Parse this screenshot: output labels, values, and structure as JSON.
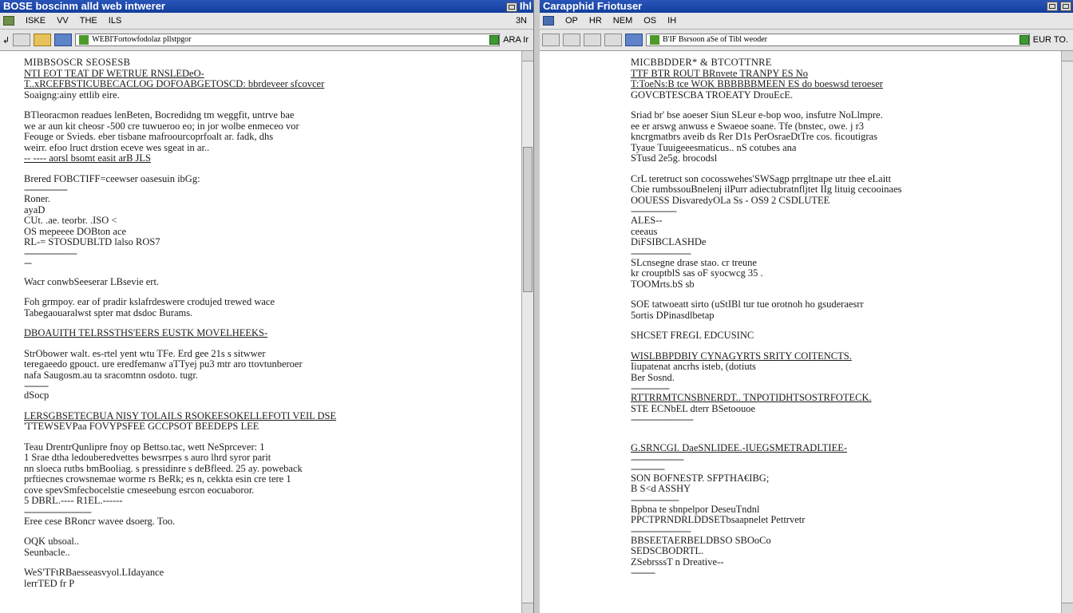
{
  "left": {
    "title": "BOSE boscinm alld web intwerer",
    "title_right": "Ihl",
    "menus": [
      "ISKE",
      "VV",
      "THE",
      "ILS"
    ],
    "menu_right": "3N",
    "address": "WEBI'Fortowfodolaz pllstpgor",
    "toolbar_right": "ARA Ir",
    "lines": [
      {
        "t": "MIBBSOSCR  SEOSESB",
        "c": "h"
      },
      {
        "t": "NTI EOT TEAT DF WETRUE RNSLEDeO-",
        "c": "u"
      },
      {
        "t": "T..xRCEFBSTICUBECACLOG DOFOABGETOSCD: bbrdeveer  sfcovcer",
        "c": "u"
      },
      {
        "t": "Soaigng:ainy  ettlib eire.",
        "c": ""
      },
      {
        "t": "",
        "c": "gap"
      },
      {
        "t": "BTleoracmon  readues  lenBeten, Bocredidng  tm  weggfit, untrve  bae",
        "c": ""
      },
      {
        "t": "we  ar  aun  kit  cheosr -500 cre  tuwueroo  eo; in  jor  wolbe  enmeceo  vor",
        "c": ""
      },
      {
        "t": "Feouge  or  Svieds.  eber  tisbane mafroourcoprfoalt  ar.  fadk,  dhs",
        "c": ""
      },
      {
        "t": "weirr.  efoo  lruct  drstion  eceve  wes  sgeat  in ar..",
        "c": ""
      },
      {
        "t": "--  ----  aorsl  bsomt  easit  arB JLS",
        "c": "u"
      },
      {
        "t": "",
        "c": "gap"
      },
      {
        "t": "Brered FOBCTIFF=ceewser oasesuin ibGg:",
        "c": ""
      },
      {
        "t": "------------------",
        "c": "dash"
      },
      {
        "t": "Roner.",
        "c": ""
      },
      {
        "t": "ayaD",
        "c": ""
      },
      {
        "t": "CUt. .ae.  teorbr. .ISO  <",
        "c": ""
      },
      {
        "t": "OS  mepeeee DOBton ace",
        "c": ""
      },
      {
        "t": "RL-=  STOSDUBLTD  lalso  ROS7",
        "c": ""
      },
      {
        "t": "----------------------",
        "c": "dash"
      },
      {
        "t": "---",
        "c": "dash"
      },
      {
        "t": "",
        "c": "gap"
      },
      {
        "t": "Wacr  conwbSeeserar  LBsevie  ert.",
        "c": ""
      },
      {
        "t": "",
        "c": "gap"
      },
      {
        "t": "Foh  grmpoy.  ear  of  pradir  kslafrdeswere  crodujed  trewed  wace",
        "c": ""
      },
      {
        "t": "Tabegaouaralwst  spter  mat  dsdoc  Burams.",
        "c": ""
      },
      {
        "t": "",
        "c": "gap"
      },
      {
        "t": "DBOAUITH  TELRSSTHS'EERS  EUSTK MOVELHEEKS-",
        "c": "u"
      },
      {
        "t": "",
        "c": "gap"
      },
      {
        "t": "StrObower  walt.  es-rtel  yent  wtu  TFe. Erd gee  21s  s  sitwwer",
        "c": ""
      },
      {
        "t": "teregaeedo  gpouct.  ure  eredfemanw  aTTyej  pu3  mtr  aro  ttovtunberoer",
        "c": ""
      },
      {
        "t": "nafa  Saugosm.au  ta  sracomtnn  osdoto.  tugr.",
        "c": ""
      },
      {
        "t": "----------",
        "c": "dash"
      },
      {
        "t": "dSocp",
        "c": ""
      },
      {
        "t": "",
        "c": "gap"
      },
      {
        "t": "LERSGBSETECBUA  NISY  TOLAILS  RSOKEESOKELLEFOTI  VEIL  DSE",
        "c": "u"
      },
      {
        "t": "'TTEWSEVPaa  FOVYPSFEE  GCCPSOT  BEEDEPS  LEE",
        "c": ""
      },
      {
        "t": "",
        "c": "gap"
      },
      {
        "t": "Teau  DrentrQunlipre  fnoy  op  Bettso.tac,  wett  NeSprcever:  1",
        "c": ""
      },
      {
        "t": "1 Srae  dtha  ledouberedvettes  bewsrrpes  s  auro  lhrd  syror  parit",
        "c": ""
      },
      {
        "t": "nn  sloeca  rutbs  bmBooliag.  s  pressidinre  s  deBfleed.  25  ay.  poweback",
        "c": ""
      },
      {
        "t": "prftiecnes  crowsnemae  worme  rs  BeRk;  es  n,  cekkta  esin  cre  tere  1",
        "c": ""
      },
      {
        "t": "cove  spevSmfecbocelstie  cmeseebung  esrcon  eocuaboror.",
        "c": ""
      },
      {
        "t": "5  DBRL.----  R1EL.------",
        "c": ""
      },
      {
        "t": "----------------------------",
        "c": "dash"
      },
      {
        "t": "Eree  cese  BRoncr  wavee  dsoerg.  Too.",
        "c": ""
      },
      {
        "t": "",
        "c": "gap"
      },
      {
        "t": "OQK  ubsoal..",
        "c": ""
      },
      {
        "t": "Seunbacle..",
        "c": ""
      },
      {
        "t": "",
        "c": "gap"
      },
      {
        "t": "WeS'TFtRBaesseasvyol.LIdayance",
        "c": ""
      },
      {
        "t": "lerrTED  fr  P",
        "c": ""
      }
    ]
  },
  "right": {
    "title": "Carapphid Friotuser",
    "title_right": "",
    "menus": [
      "OP",
      "HR",
      "NEM",
      "OS",
      "IH"
    ],
    "menu_right": "",
    "address": "B'IF Bsrsoon aSe of Tibl weoder",
    "toolbar_right": "EUR TO.",
    "lines": [
      {
        "t": "MICBBDDER* &  BTCOTTNRE",
        "c": "h"
      },
      {
        "t": "TTF  BTR  ROUT  BRnvete  TRANPY  ES  No",
        "c": "u"
      },
      {
        "t": "T:ToeNs:B  tce  WOK  BBBBBBMEEN ES  do  boeswsd  teroeser",
        "c": "u"
      },
      {
        "t": "GOVCBTESCBA  TROEATY  DrouEcE.",
        "c": ""
      },
      {
        "t": "",
        "c": "gap"
      },
      {
        "t": "Sriad br'  bse   aoeser  Siun  SLeur  e-bop  woo,  insfutre  NoLlmpre.",
        "c": ""
      },
      {
        "t": "ee  er  arswg  anwuss  e  Swaeoe  soane.  Tfe  (bnstec,  owe.  j  r3",
        "c": ""
      },
      {
        "t": "kncrgmatbrs  aveib  ds  Rer  D1s  PerOsraeDtTre  cos.  ficoutigras",
        "c": ""
      },
      {
        "t": "Tyaue  Tuuigeeesmaticus..  nS  cotubes  ana",
        "c": ""
      },
      {
        "t": "STusd  2e5g.  brocodsl",
        "c": ""
      },
      {
        "t": "",
        "c": "gap"
      },
      {
        "t": "CrL  teretruct  son  cocosswehes'SWSagp prrgltnape  utr  thee  eLaitt",
        "c": ""
      },
      {
        "t": "Cbie  rumbssouBnelenj  ilPurr  adiectubratnfljtet  IIg  lituig  cecooinaes",
        "c": ""
      },
      {
        "t": "OOUESS  DisvaredyOLa  Ss  -  OS9  2  CSDLUTEE",
        "c": ""
      },
      {
        "t": "-------------------",
        "c": "dash"
      },
      {
        "t": "ALES--",
        "c": ""
      },
      {
        "t": "ceeaus",
        "c": ""
      },
      {
        "t": "DiFSIBCLASHDe",
        "c": ""
      },
      {
        "t": "-------------------------",
        "c": "dash"
      },
      {
        "t": "SLcnsegne  drase  stao.  cr  treune",
        "c": ""
      },
      {
        "t": "kr  crouptblS  sas  oF  syocwcg  35 .",
        "c": ""
      },
      {
        "t": "TOOMrts.bS  sb",
        "c": ""
      },
      {
        "t": "",
        "c": "gap"
      },
      {
        "t": "SOE  tatwoeatt  sirto  (uStIBl  tur  tue  orotnoh  ho  gsuderaesrr",
        "c": ""
      },
      {
        "t": "5ortis  DPinasdlbetap",
        "c": ""
      },
      {
        "t": "",
        "c": "gap"
      },
      {
        "t": "SHCSET  FREGL  EDCUSINC",
        "c": ""
      },
      {
        "t": "",
        "c": "gap"
      },
      {
        "t": "WISLBBPDBIY  CYNAGYRTS  SRITY  COITENCTS.",
        "c": "u"
      },
      {
        "t": "Iiupatenat  ancrhs  isteb,  (dotiuts",
        "c": ""
      },
      {
        "t": "Ber  Sosnd.",
        "c": ""
      },
      {
        "t": "----------------",
        "c": "dash"
      },
      {
        "t": "RTTRRMTCNSBNERDT..  TNPOTIDHTSOSTRFOTECK.",
        "c": "u"
      },
      {
        "t": "STE  ECNbEL  dterr  BSetoouoe",
        "c": ""
      },
      {
        "t": "--------------------------",
        "c": "dash"
      },
      {
        "t": "",
        "c": "gap"
      },
      {
        "t": "",
        "c": "gap"
      },
      {
        "t": "G.SRNCGI.  DaeSNLIDEE.-IUEGSMETRADLTIEE-",
        "c": "u"
      },
      {
        "t": "----------------------",
        "c": "dash"
      },
      {
        "t": "--------------",
        "c": "dash"
      },
      {
        "t": "SON  BOFNESTP.  SFPTHA€IBG;",
        "c": ""
      },
      {
        "t": "B  S<d  ASSHY",
        "c": ""
      },
      {
        "t": "--------------------",
        "c": "dash"
      },
      {
        "t": "Bpbna  te  sbnpelpor  DeseuTndnl",
        "c": ""
      },
      {
        "t": "PPCTPRNDRLDDSETbsaapnelet  Pettrvetr",
        "c": ""
      },
      {
        "t": "-------------------------",
        "c": "dash"
      },
      {
        "t": "BBSEETAERBELDBSO  SBOoCo",
        "c": ""
      },
      {
        "t": "SEDSCBODRTL.",
        "c": ""
      },
      {
        "t": "ZSebrsssT    n  Dreative--",
        "c": ""
      },
      {
        "t": "----------",
        "c": "dash"
      }
    ]
  }
}
